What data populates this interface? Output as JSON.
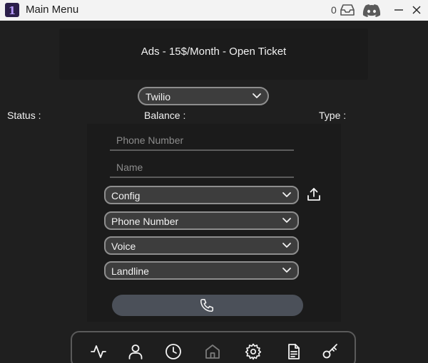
{
  "window": {
    "title": "Main Menu",
    "inbox_count": "0"
  },
  "ad_banner": {
    "text": "Ads - 15$/Month - Open Ticket"
  },
  "provider": {
    "selected": "Twilio"
  },
  "info": {
    "status_label": "Status :",
    "balance_label": "Balance :",
    "type_label": "Type :"
  },
  "form": {
    "phone_placeholder": "Phone Number",
    "name_placeholder": "Name",
    "dropdowns": [
      {
        "selected": "Config"
      },
      {
        "selected": "Phone Number"
      },
      {
        "selected": "Voice"
      },
      {
        "selected": "Landline"
      }
    ]
  },
  "icons": {
    "app": "app-logo-icon",
    "inbox": "inbox-icon",
    "discord": "discord-icon",
    "upload": "upload-icon",
    "call": "phone-icon",
    "nav": [
      "activity-icon",
      "user-icon",
      "clock-icon",
      "home-icon",
      "gear-icon",
      "document-icon",
      "key-icon"
    ]
  },
  "colors": {
    "background": "#1f1f1f",
    "titlebar": "#f3f3f3",
    "control": "#3d3d3d",
    "control_border": "#8e8e8e",
    "call_button": "#4b5059"
  }
}
